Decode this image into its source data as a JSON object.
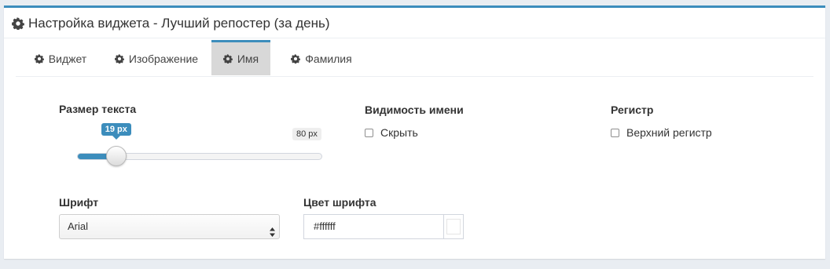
{
  "header": {
    "title": "Настройка виджета - Лучший репостер (за день)",
    "icon": "gear-icon"
  },
  "tabs": [
    {
      "label": "Виджет",
      "icon": "gear-icon",
      "active": false
    },
    {
      "label": "Изображение",
      "icon": "gear-icon",
      "active": false
    },
    {
      "label": "Имя",
      "icon": "gear-icon",
      "active": true
    },
    {
      "label": "Фамилия",
      "icon": "gear-icon",
      "active": false
    }
  ],
  "text_size": {
    "label": "Размер текста",
    "current_label": "19 px",
    "max_label": "80 px",
    "current_value": 19,
    "max_value": 80
  },
  "name_visibility": {
    "label": "Видимость имени",
    "checkbox_label": "Скрыть",
    "checked": false
  },
  "case": {
    "label": "Регистр",
    "checkbox_label": "Верхний регистр",
    "checked": false
  },
  "font": {
    "label": "Шрифт",
    "selected": "Arial"
  },
  "font_color": {
    "label": "Цвет шрифта",
    "value": "#ffffff"
  },
  "colors": {
    "accent": "#3c8dbc",
    "active_tab_bg": "#d8d8d8",
    "page_bg": "#e9edf2"
  }
}
